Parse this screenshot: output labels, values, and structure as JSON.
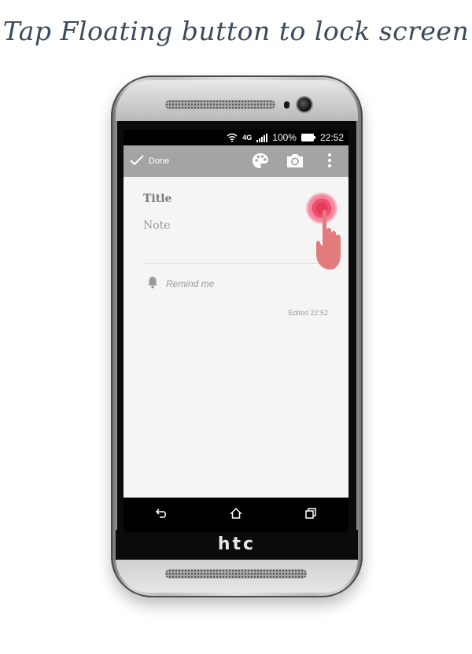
{
  "headline": "Tap Floating button to lock screen",
  "device": {
    "brand_logo": "htc"
  },
  "status_bar": {
    "network": "4G",
    "battery_percent": "100%",
    "time": "22:52",
    "icons": [
      "wifi-icon",
      "network-4g-icon",
      "signal-icon",
      "battery-icon"
    ]
  },
  "action_bar": {
    "done_label": "Done",
    "icons": [
      "checkmark-icon",
      "palette-icon",
      "camera-icon",
      "overflow-menu-icon"
    ],
    "background": "#a4a4a4"
  },
  "note": {
    "title_placeholder": "Title",
    "body_placeholder": "Note",
    "reminder_label": "Remind me",
    "edited_label": "Edited 22:52"
  },
  "floating_button": {
    "color": "#e8385e",
    "icon": "floating-lock-button"
  },
  "nav_bar": {
    "icons": [
      "back-icon",
      "home-icon",
      "recent-apps-icon"
    ]
  }
}
